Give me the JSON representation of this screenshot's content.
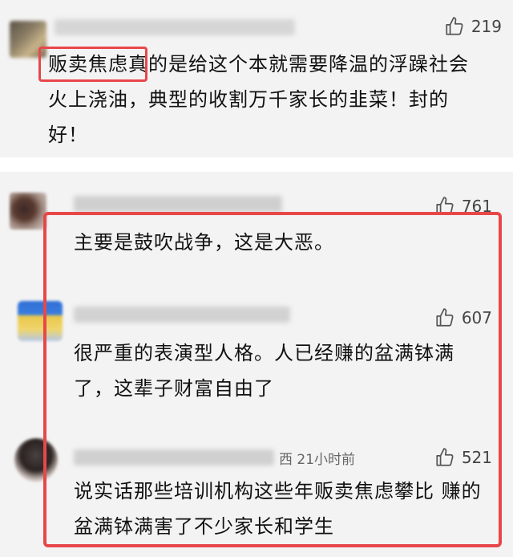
{
  "comments": [
    {
      "likes": "219",
      "text": "贩卖焦虑真的是给这个本就需要降温的浮躁社会火上浇油，典型的收割万千家长的韭菜！封的好！",
      "highlight_phrase": "贩卖焦虑"
    },
    {
      "likes": "761",
      "text": "主要是鼓吹战争，这是大恶。"
    },
    {
      "likes": "607",
      "text": "很严重的表演型人格。人已经赚的盆满钵满了，这辈子财富自由了"
    },
    {
      "likes": "521",
      "time": "西 21小时前",
      "text": "说实话那些培训机构这些年贩卖焦虑攀比 赚的盆满钵满害了不少家长和学生"
    }
  ],
  "icons": {
    "like": "thumbs-up-icon"
  },
  "colors": {
    "highlight_border": "#e8474a",
    "card_background": "#f3f3f3",
    "text": "#111111"
  }
}
